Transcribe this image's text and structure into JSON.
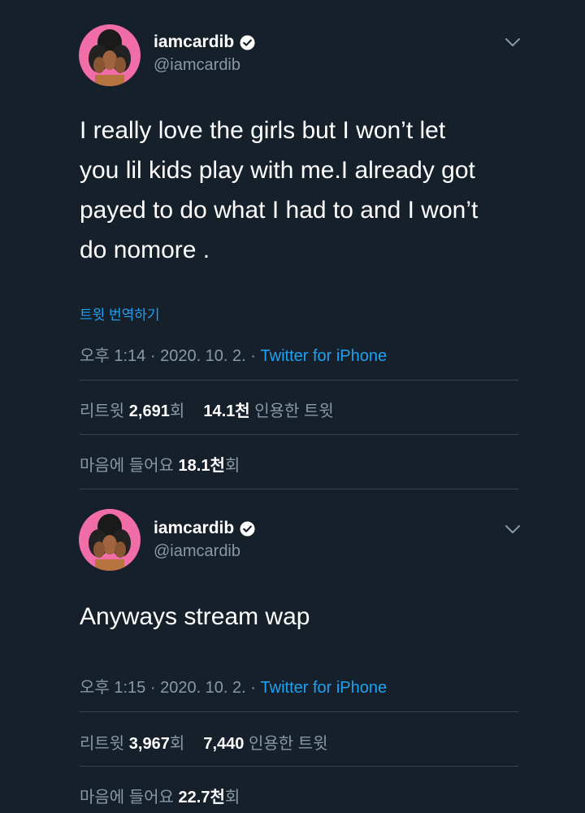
{
  "tweets": [
    {
      "author": {
        "name": "iamcardib",
        "handle": "@iamcardib"
      },
      "text_lines": [
        "I really love the girls but I won’t let",
        "you lil kids play with me.I already got",
        "payed to do what I had to and I won’t",
        "do nomore ."
      ],
      "translate_label": "트윗 번역하기",
      "time": "오후 1:14",
      "date": "2020. 10. 2.",
      "app": "Twitter for iPhone",
      "retweets": {
        "label": "리트윗",
        "count": "2,691",
        "suffix": "회"
      },
      "quotes": {
        "count": "14.1천",
        "label": "인용한 트윗"
      },
      "likes": {
        "label": "마음에 들어요",
        "count": "18.1천",
        "suffix": "회"
      }
    },
    {
      "author": {
        "name": "iamcardib",
        "handle": "@iamcardib"
      },
      "text_lines": [
        "Anyways stream wap"
      ],
      "time": "오후 1:15",
      "date": "2020. 10. 2.",
      "app": "Twitter for iPhone",
      "retweets": {
        "label": "리트윗",
        "count": "3,967",
        "suffix": "회"
      },
      "quotes": {
        "count": "7,440",
        "label": "인용한 트윗"
      },
      "likes": {
        "label": "마음에 들어요",
        "count": "22.7천",
        "suffix": "회"
      }
    }
  ],
  "separator": " · ",
  "icons": {
    "verified": "verified-badge-icon",
    "menu": "chevron-down-icon"
  },
  "colors": {
    "background": "#15202b",
    "accent": "#1da1f2",
    "muted": "#8899a6",
    "divider": "#38444d",
    "avatar_bg": "#f06da8"
  }
}
